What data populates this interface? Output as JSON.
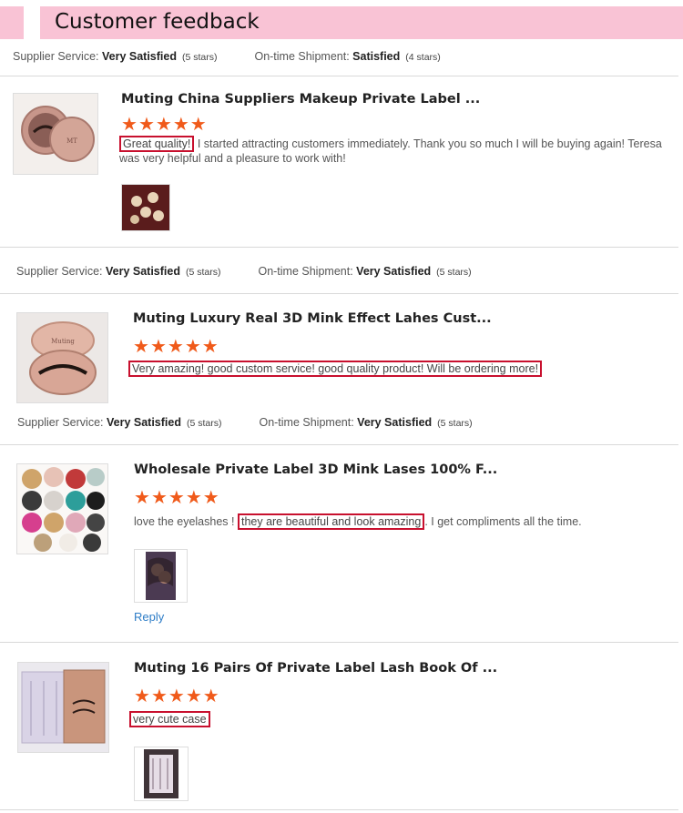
{
  "header": {
    "title": "Customer feedback"
  },
  "labels": {
    "supplier_service": "Supplier Service:",
    "ontime_shipment": "On-time Shipment:"
  },
  "top_meta": {
    "service_value": "Very Satisfied",
    "service_stars": "(5 stars)",
    "shipment_value": "Satisfied",
    "shipment_stars": "(4 stars)"
  },
  "reviews": [
    {
      "title": "Muting China Suppliers Makeup Private Label ...",
      "rating": 5,
      "text_highlight": "Great quality!",
      "text_after": " I started attracting customers immediately. Thank you so much I will be buying again! Teresa was very helpful and a pleasure to work with!",
      "after_meta": {
        "service_value": "Very Satisfied",
        "service_stars": "(5 stars)",
        "shipment_value": "Very Satisfied",
        "shipment_stars": "(5 stars)"
      }
    },
    {
      "title": "Muting Luxury Real 3D Mink Effect Lahes Cust...",
      "rating": 5,
      "text_highlight": "Very amazing! good custom service! good quality product! Will be ordering more!",
      "after_meta": {
        "service_value": "Very Satisfied",
        "service_stars": "(5 stars)",
        "shipment_value": "Very Satisfied",
        "shipment_stars": "(5 stars)"
      }
    },
    {
      "title": "Wholesale Private Label 3D Mink Lases 100% F...",
      "rating": 5,
      "text_before": "love the eyelashes ! ",
      "text_highlight": "they are beautiful and look amazing",
      "text_after": ". I get compliments all the time.",
      "reply_label": "Reply"
    },
    {
      "title": "Muting 16 Pairs Of Private Label Lash Book Of ...",
      "rating": 5,
      "text_highlight": "very cute case"
    }
  ],
  "colors": {
    "header_bg": "#f9c3d5",
    "star": "#f05a1a",
    "highlight_border": "#c8102e",
    "link": "#2e7dc7"
  }
}
